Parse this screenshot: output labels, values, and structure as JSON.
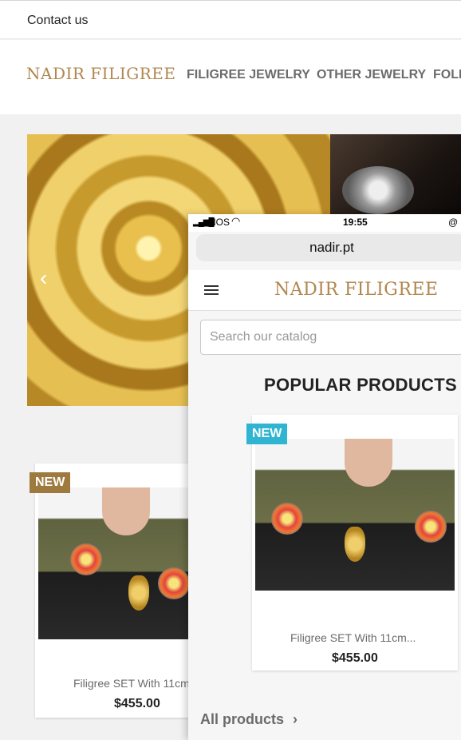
{
  "top_bar": {
    "contact": "Contact us"
  },
  "header": {
    "logo": "NADIR FILIGREE",
    "nav": [
      "FILIGREE JEWELRY",
      "OTHER JEWELRY",
      "FOLK"
    ]
  },
  "hero": {
    "prev_icon": "chevron-left-icon",
    "prev_glyph": "‹"
  },
  "product": {
    "badge": "NEW",
    "name_desktop": "Filigree SET With 11cm",
    "name_mobile": "Filigree SET With 11cm...",
    "price": "$455.00"
  },
  "mobile": {
    "status": {
      "carrier": "NOS",
      "time": "19:55"
    },
    "url": "nadir.pt",
    "logo": "NADIR FILIGREE",
    "search_placeholder": "Search our catalog",
    "section_title": "POPULAR PRODUCTS",
    "all_products": "All products",
    "all_products_icon": "chevron-right-icon",
    "chevron_glyph": "›"
  },
  "colors": {
    "brand_gold": "#b0874f",
    "badge_desktop": "#9f7a3e",
    "badge_mobile": "#2fb5d2",
    "nav_text": "#6b6b6b"
  }
}
